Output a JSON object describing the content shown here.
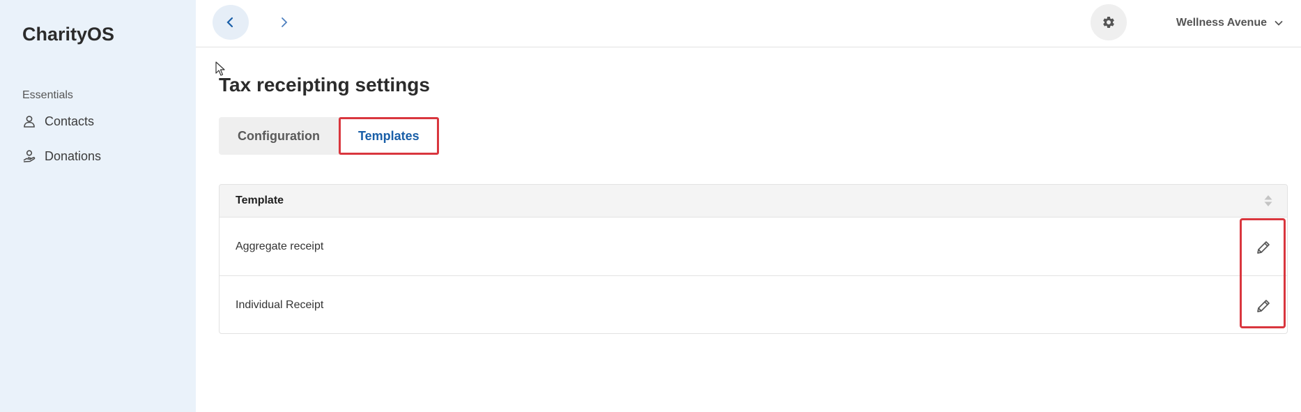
{
  "app": {
    "brand": "CharityOS"
  },
  "sidebar": {
    "section": "Essentials",
    "items": [
      {
        "label": "Contacts",
        "icon": "person-icon"
      },
      {
        "label": "Donations",
        "icon": "hand-coin-icon"
      }
    ]
  },
  "topbar": {
    "back_icon": "chevron-left-icon",
    "forward_icon": "chevron-right-icon",
    "settings_icon": "gear-icon",
    "org_name": "Wellness Avenue",
    "org_dropdown_icon": "chevron-down-icon"
  },
  "page": {
    "title": "Tax receipting settings",
    "tabs": [
      {
        "label": "Configuration",
        "active": false
      },
      {
        "label": "Templates",
        "active": true
      }
    ]
  },
  "table": {
    "header": "Template",
    "rows": [
      {
        "name": "Aggregate receipt",
        "action_icon": "pencil-icon"
      },
      {
        "name": "Individual Receipt",
        "action_icon": "pencil-icon"
      }
    ]
  },
  "colors": {
    "sidebar_bg": "#eaf2fa",
    "accent": "#1a5fa8",
    "highlight": "#d9363e"
  }
}
